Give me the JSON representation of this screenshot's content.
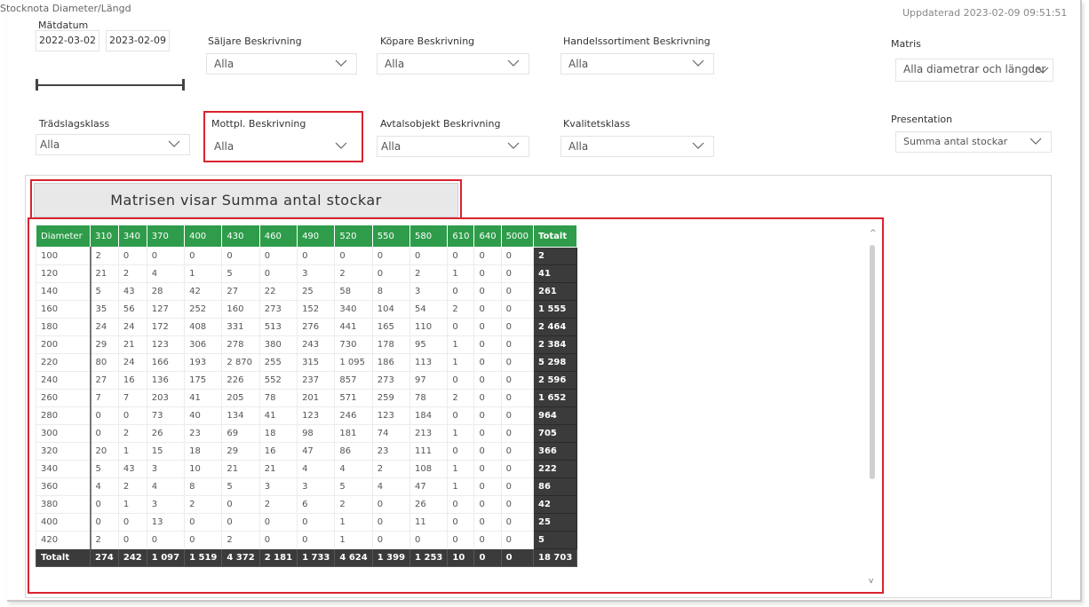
{
  "report": {
    "title": "Stocknota Diameter/Längd",
    "updated_label": "Uppdaterad",
    "updated_value": "2023-02-09 09:51:51"
  },
  "filters": {
    "matdatum": {
      "label": "Mätdatum",
      "from": "2022-03-02",
      "to": "2023-02-09"
    },
    "saljare": {
      "label": "Säljare Beskrivning",
      "value": "Alla"
    },
    "kopare": {
      "label": "Köpare Beskrivning",
      "value": "Alla"
    },
    "handelssortiment": {
      "label": "Handelssortiment Beskrivning",
      "value": "Alla"
    },
    "matris": {
      "label": "Matris",
      "value": "Alla diametrar och längder"
    },
    "tradslagsklass": {
      "label": "Trädslagsklass",
      "value": "Alla"
    },
    "mottpl": {
      "label": "Mottpl. Beskrivning",
      "value": "Alla"
    },
    "avtalsobjekt": {
      "label": "Avtalsobjekt Beskrivning",
      "value": "Alla"
    },
    "kvalitetsklass": {
      "label": "Kvalitetsklass",
      "value": "Alla"
    },
    "presentation": {
      "label": "Presentation",
      "value": "Summa antal stockar"
    }
  },
  "banner": "Matrisen visar Summa antal stockar",
  "matrix": {
    "header_first": "Diameter",
    "columns": [
      "310",
      "340",
      "370",
      "400",
      "430",
      "460",
      "490",
      "520",
      "550",
      "580",
      "610",
      "640",
      "5000"
    ],
    "header_total": "Totalt",
    "rows": [
      {
        "d": "100",
        "v": [
          "2",
          "0",
          "0",
          "0",
          "0",
          "0",
          "0",
          "0",
          "0",
          "0",
          "0",
          "0",
          "0"
        ],
        "t": "2"
      },
      {
        "d": "120",
        "v": [
          "21",
          "2",
          "4",
          "1",
          "5",
          "0",
          "3",
          "2",
          "0",
          "2",
          "1",
          "0",
          "0"
        ],
        "t": "41"
      },
      {
        "d": "140",
        "v": [
          "5",
          "43",
          "28",
          "42",
          "27",
          "22",
          "25",
          "58",
          "8",
          "3",
          "0",
          "0",
          "0"
        ],
        "t": "261"
      },
      {
        "d": "160",
        "v": [
          "35",
          "56",
          "127",
          "252",
          "160",
          "273",
          "152",
          "340",
          "104",
          "54",
          "2",
          "0",
          "0"
        ],
        "t": "1 555"
      },
      {
        "d": "180",
        "v": [
          "24",
          "24",
          "172",
          "408",
          "331",
          "513",
          "276",
          "441",
          "165",
          "110",
          "0",
          "0",
          "0"
        ],
        "t": "2 464"
      },
      {
        "d": "200",
        "v": [
          "29",
          "21",
          "123",
          "306",
          "278",
          "380",
          "243",
          "730",
          "178",
          "95",
          "1",
          "0",
          "0"
        ],
        "t": "2 384"
      },
      {
        "d": "220",
        "v": [
          "80",
          "24",
          "166",
          "193",
          "2 870",
          "255",
          "315",
          "1 095",
          "186",
          "113",
          "1",
          "0",
          "0"
        ],
        "t": "5 298"
      },
      {
        "d": "240",
        "v": [
          "27",
          "16",
          "136",
          "175",
          "226",
          "552",
          "237",
          "857",
          "273",
          "97",
          "0",
          "0",
          "0"
        ],
        "t": "2 596"
      },
      {
        "d": "260",
        "v": [
          "7",
          "7",
          "203",
          "41",
          "205",
          "78",
          "201",
          "571",
          "259",
          "78",
          "2",
          "0",
          "0"
        ],
        "t": "1 652"
      },
      {
        "d": "280",
        "v": [
          "0",
          "0",
          "73",
          "40",
          "134",
          "41",
          "123",
          "246",
          "123",
          "184",
          "0",
          "0",
          "0"
        ],
        "t": "964"
      },
      {
        "d": "300",
        "v": [
          "0",
          "2",
          "26",
          "23",
          "69",
          "18",
          "98",
          "181",
          "74",
          "213",
          "1",
          "0",
          "0"
        ],
        "t": "705"
      },
      {
        "d": "320",
        "v": [
          "20",
          "1",
          "15",
          "18",
          "29",
          "16",
          "47",
          "86",
          "23",
          "111",
          "0",
          "0",
          "0"
        ],
        "t": "366"
      },
      {
        "d": "340",
        "v": [
          "5",
          "43",
          "3",
          "10",
          "21",
          "21",
          "4",
          "4",
          "2",
          "108",
          "1",
          "0",
          "0"
        ],
        "t": "222"
      },
      {
        "d": "360",
        "v": [
          "4",
          "2",
          "4",
          "8",
          "5",
          "3",
          "3",
          "5",
          "4",
          "47",
          "1",
          "0",
          "0"
        ],
        "t": "86"
      },
      {
        "d": "380",
        "v": [
          "0",
          "1",
          "3",
          "2",
          "0",
          "2",
          "6",
          "2",
          "0",
          "26",
          "0",
          "0",
          "0"
        ],
        "t": "42"
      },
      {
        "d": "400",
        "v": [
          "0",
          "0",
          "13",
          "0",
          "0",
          "0",
          "0",
          "1",
          "0",
          "11",
          "0",
          "0",
          "0"
        ],
        "t": "25"
      },
      {
        "d": "420",
        "v": [
          "2",
          "0",
          "0",
          "0",
          "2",
          "0",
          "0",
          "1",
          "0",
          "0",
          "0",
          "0",
          "0"
        ],
        "t": "5"
      }
    ],
    "total_row": {
      "label": "Totalt",
      "v": [
        "274",
        "242",
        "1 097",
        "1 519",
        "4 372",
        "2 181",
        "1 733",
        "4 624",
        "1 399",
        "1 253",
        "10",
        "0",
        "0"
      ],
      "t": "18 703"
    }
  },
  "colors": {
    "header_green": "#2e9c4a",
    "total_dark": "#3b3b3b",
    "highlight_red": "#d9232f"
  },
  "icons": {
    "dropdown": "chevron-down-icon",
    "scroll_up": "scroll-up-arrow-icon",
    "scroll_down": "scroll-down-arrow-icon"
  }
}
